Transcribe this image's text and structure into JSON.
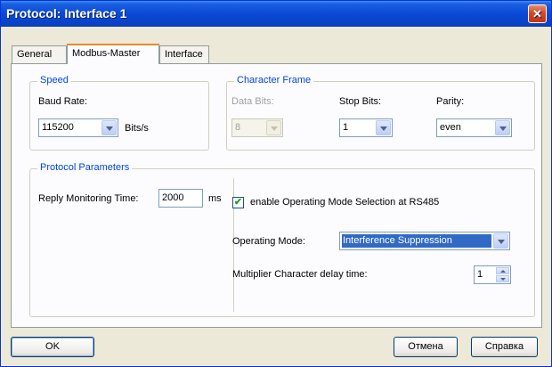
{
  "window": {
    "title": "Protocol: Interface 1",
    "close_glyph": "✕"
  },
  "tabs": [
    "General",
    "Modbus-Master",
    "Interface"
  ],
  "speed": {
    "group_title": "Speed",
    "baud_label": "Baud Rate:",
    "baud_value": "115200",
    "baud_unit": "Bits/s"
  },
  "character_frame": {
    "group_title": "Character Frame",
    "data_bits_label": "Data Bits:",
    "data_bits_value": "8",
    "stop_bits_label": "Stop Bits:",
    "stop_bits_value": "1",
    "parity_label": "Parity:",
    "parity_value": "even"
  },
  "protocol_params": {
    "group_title": "Protocol Parameters",
    "reply_label": "Reply Monitoring Time:",
    "reply_value": "2000",
    "reply_unit": "ms",
    "checkbox_checked": true,
    "checkbox_glyph": "✔",
    "checkbox_label": "enable Operating Mode Selection at RS485",
    "op_mode_label": "Operating Mode:",
    "op_mode_value": "Interference Suppression",
    "multiplier_label": "Multiplier Character delay time:",
    "multiplier_value": "1"
  },
  "buttons": {
    "ok": "OK",
    "cancel": "Отмена",
    "help": "Справка"
  },
  "colors": {
    "titlebar": "#0a4ad6",
    "group_title": "#0046d5",
    "selection": "#316ac5"
  }
}
